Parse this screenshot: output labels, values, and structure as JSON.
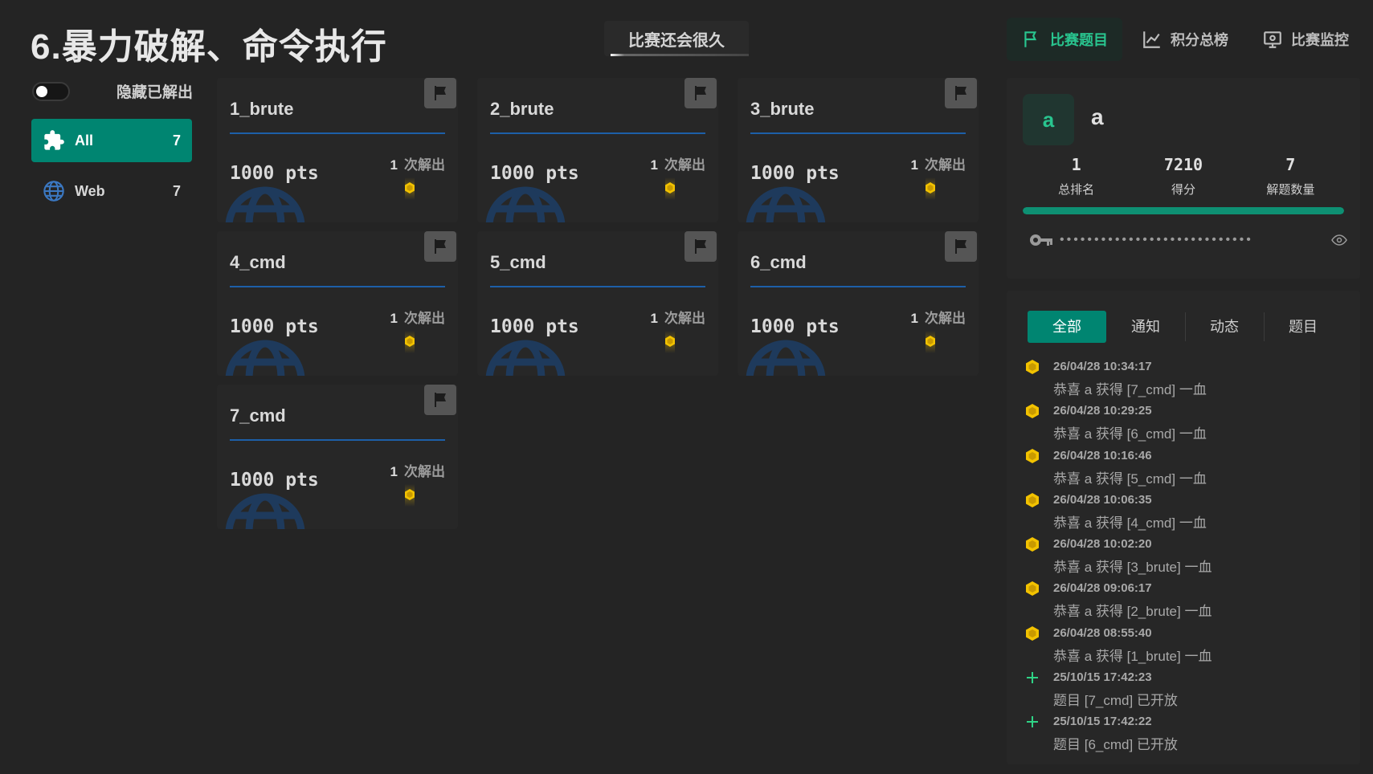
{
  "header": {
    "title": "6.暴力破解、命令执行",
    "countdown": "比赛还会很久",
    "nav": [
      {
        "label": "比赛题目",
        "icon": "flag-icon",
        "active": true
      },
      {
        "label": "积分总榜",
        "icon": "chart-icon",
        "active": false
      },
      {
        "label": "比赛监控",
        "icon": "monitor-icon",
        "active": false
      }
    ]
  },
  "sidebar": {
    "hide_solved_label": "隐藏已解出",
    "hide_solved_on": false,
    "categories": [
      {
        "label": "All",
        "count": "7",
        "icon": "puzzle-icon",
        "active": true
      },
      {
        "label": "Web",
        "count": "7",
        "icon": "globe-icon",
        "active": false
      }
    ]
  },
  "challenges": [
    {
      "name": "1_brute",
      "points": "1000 pts",
      "solves": "1",
      "solves_label": "次解出"
    },
    {
      "name": "2_brute",
      "points": "1000 pts",
      "solves": "1",
      "solves_label": "次解出"
    },
    {
      "name": "3_brute",
      "points": "1000 pts",
      "solves": "1",
      "solves_label": "次解出"
    },
    {
      "name": "4_cmd",
      "points": "1000 pts",
      "solves": "1",
      "solves_label": "次解出"
    },
    {
      "name": "5_cmd",
      "points": "1000 pts",
      "solves": "1",
      "solves_label": "次解出"
    },
    {
      "name": "6_cmd",
      "points": "1000 pts",
      "solves": "1",
      "solves_label": "次解出"
    },
    {
      "name": "7_cmd",
      "points": "1000 pts",
      "solves": "1",
      "solves_label": "次解出"
    }
  ],
  "user": {
    "avatar_letter": "a",
    "name": "a",
    "stats": [
      {
        "value": "1",
        "label": "总排名"
      },
      {
        "value": "7210",
        "label": "得分"
      },
      {
        "value": "7",
        "label": "解题数量"
      }
    ],
    "progress_fraction": 1.0,
    "token_mask": "••••••••••••••••••••••••••••"
  },
  "notices": {
    "tabs": [
      {
        "label": "全部",
        "active": true
      },
      {
        "label": "通知",
        "active": false
      },
      {
        "label": "动态",
        "active": false
      },
      {
        "label": "题目",
        "active": false
      }
    ],
    "items": [
      {
        "type": "blood",
        "time": "26/04/28 10:34:17",
        "text": "恭喜 a 获得 [7_cmd] 一血"
      },
      {
        "type": "blood",
        "time": "26/04/28 10:29:25",
        "text": "恭喜 a 获得 [6_cmd] 一血"
      },
      {
        "type": "blood",
        "time": "26/04/28 10:16:46",
        "text": "恭喜 a 获得 [5_cmd] 一血"
      },
      {
        "type": "blood",
        "time": "26/04/28 10:06:35",
        "text": "恭喜 a 获得 [4_cmd] 一血"
      },
      {
        "type": "blood",
        "time": "26/04/28 10:02:20",
        "text": "恭喜 a 获得 [3_brute] 一血"
      },
      {
        "type": "blood",
        "time": "26/04/28 09:06:17",
        "text": "恭喜 a 获得 [2_brute] 一血"
      },
      {
        "type": "blood",
        "time": "26/04/28 08:55:40",
        "text": "恭喜 a 获得 [1_brute] 一血"
      },
      {
        "type": "new",
        "time": "25/10/15 17:42:23",
        "text": "题目 [7_cmd] 已开放"
      },
      {
        "type": "new",
        "time": "25/10/15 17:42:22",
        "text": "题目 [6_cmd] 已开放"
      }
    ]
  },
  "colors": {
    "accent": "#008571",
    "accent_text": "#29c58f",
    "medal": "#f2c200",
    "underline": "#1d5fa8"
  }
}
